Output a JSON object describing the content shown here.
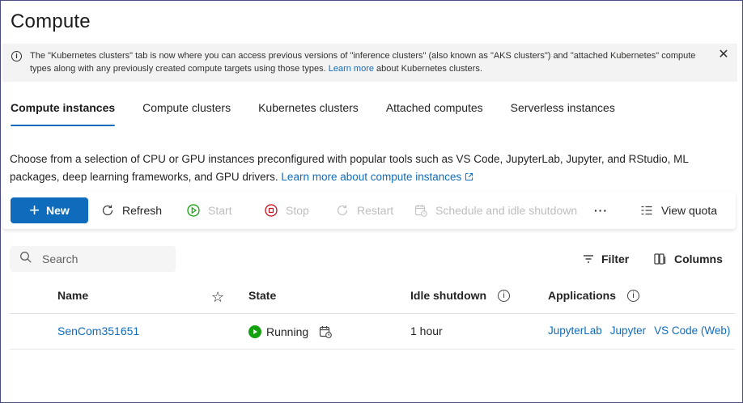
{
  "page": {
    "title": "Compute"
  },
  "banner": {
    "text_before": "The \"Kubernetes clusters\" tab is now where you can access previous versions of \"inference clusters\" (also known as \"AKS clusters\") and \"attached Kubernetes\" compute types along with any previously created compute targets using those types. ",
    "link_label": "Learn more",
    "text_after": " about Kubernetes clusters."
  },
  "tabs": [
    {
      "label": "Compute instances",
      "active": true
    },
    {
      "label": "Compute clusters"
    },
    {
      "label": "Kubernetes clusters"
    },
    {
      "label": "Attached computes"
    },
    {
      "label": "Serverless instances"
    }
  ],
  "description": {
    "text": "Choose from a selection of CPU or GPU instances preconfigured with popular tools such as VS Code, JupyterLab, Jupyter, and RStudio, ML packages, deep learning frameworks, and GPU drivers. ",
    "link_label": "Learn more about compute instances"
  },
  "toolbar": {
    "new_label": "New",
    "refresh_label": "Refresh",
    "start_label": "Start",
    "stop_label": "Stop",
    "restart_label": "Restart",
    "schedule_label": "Schedule and idle shutdown",
    "more_label": "···",
    "view_quota_label": "View quota"
  },
  "search": {
    "placeholder": "Search"
  },
  "filter_label": "Filter",
  "columns_label": "Columns",
  "table": {
    "headers": {
      "name": "Name",
      "state": "State",
      "idle": "Idle shutdown",
      "apps": "Applications"
    },
    "rows": [
      {
        "name": "SenCom351651",
        "state": "Running",
        "idle": "1 hour",
        "apps": [
          "JupyterLab",
          "Jupyter",
          "VS Code (Web)"
        ]
      }
    ]
  },
  "colors": {
    "accent": "#0f6cbd",
    "running": "#13a10e"
  }
}
